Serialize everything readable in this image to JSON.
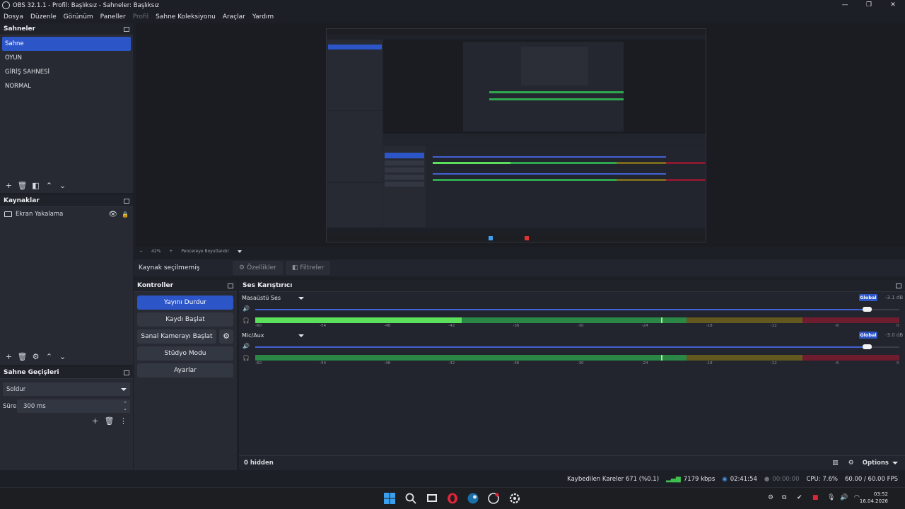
{
  "window": {
    "title": "OBS 32.1.1 - Profil: Başlıksız - Sahneler: Başlıksız",
    "controls": [
      "—",
      "❐",
      "✕"
    ]
  },
  "menu": [
    {
      "label": "Dosya",
      "enabled": true
    },
    {
      "label": "Düzenle",
      "enabled": true
    },
    {
      "label": "Görünüm",
      "enabled": true
    },
    {
      "label": "Paneller",
      "enabled": true
    },
    {
      "label": "Profil",
      "enabled": false
    },
    {
      "label": "Sahne Koleksiyonu",
      "enabled": true
    },
    {
      "label": "Araçlar",
      "enabled": true
    },
    {
      "label": "Yardım",
      "enabled": true
    }
  ],
  "scenes": {
    "title": "Sahneler",
    "items": [
      "Sahne",
      "OYUN",
      "GİRİŞ SAHNESİ",
      "NORMAL"
    ],
    "selected": "Sahne"
  },
  "sources": {
    "title": "Kaynaklar",
    "items": [
      {
        "label": "Ekran Yakalama",
        "visible": true,
        "locked": false
      }
    ]
  },
  "transitions": {
    "title": "Sahne Geçişleri",
    "selected": "Soldur",
    "duration_label": "Süre",
    "duration_value": "300 ms"
  },
  "preview": {
    "zoom": "42%",
    "fit_label": "Pencereye Boyutlandır",
    "minus": "−",
    "plus": "+"
  },
  "context": {
    "no_source": "Kaynak seçilmemiş",
    "properties": "Özellikler",
    "filters": "Filtreler"
  },
  "controls": {
    "title": "Kontroller",
    "stop_stream": "Yayını Durdur",
    "start_recording": "Kaydı Başlat",
    "start_virtualcam": "Sanal Kamerayı Başlat",
    "studio_mode": "Stüdyo Modu",
    "settings": "Ayarlar"
  },
  "mixer": {
    "title": "Ses Karıştırıcı",
    "channels": [
      {
        "name": "Masaüstü Ses",
        "badge": "Global",
        "db": "-3.1 dB",
        "volume": 0.95,
        "level_peak": 0.32,
        "level_hold": 0.63
      },
      {
        "name": "Mic/Aux",
        "badge": "Global",
        "db": "-3.0 dB",
        "volume": 0.95,
        "level_peak": 0.0,
        "level_hold": 0.63
      }
    ],
    "ticks": [
      "-60",
      "-54",
      "-48",
      "-42",
      "-36",
      "-30",
      "-24",
      "-18",
      "-12",
      "-6",
      "0"
    ],
    "hidden_label": "0 hidden",
    "options_label": "Options"
  },
  "status": {
    "dropped_frames": "Kaybedilen Kareler 671 (%0.1)",
    "bitrate": "7179 kbps",
    "stream_time": "02:41:54",
    "record_time": "00:00:00",
    "cpu": "CPU: 7.6%",
    "fps": "60.00 / 60.00 FPS"
  },
  "taskbar": {
    "time": "03:52",
    "date": "16.04.2026",
    "apps": [
      "windows-start",
      "search",
      "file-explorer",
      "opera",
      "steam",
      "obs",
      "obs-settings"
    ]
  },
  "colors": {
    "accent": "#2c56c8",
    "meter_green": "#2fa84f",
    "meter_green_bright": "#5be05b",
    "meter_yellow": "#7a6a1c",
    "meter_red": "#8b1a30"
  }
}
